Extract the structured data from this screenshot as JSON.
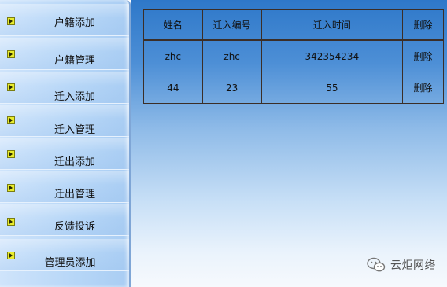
{
  "sidebar": {
    "items": [
      {
        "label": "户籍添加",
        "icon": "arrow-bullet-icon"
      },
      {
        "label": "户籍管理",
        "icon": "arrow-bullet-icon"
      },
      {
        "label": "迁入添加",
        "icon": "arrow-bullet-icon"
      },
      {
        "label": "迁入管理",
        "icon": "arrow-bullet-icon"
      },
      {
        "label": "迁出添加",
        "icon": "arrow-bullet-icon"
      },
      {
        "label": "迁出管理",
        "icon": "arrow-bullet-icon"
      },
      {
        "label": "反馈投诉",
        "icon": "arrow-bullet-icon"
      },
      {
        "label": "管理员添加",
        "icon": "arrow-bullet-icon"
      }
    ],
    "icon_color": "#e9ec2d"
  },
  "table": {
    "headers": [
      "姓名",
      "迁入编号",
      "迁入时间",
      "删除"
    ],
    "rows": [
      {
        "name": "zhc",
        "number": "zhc",
        "time": "342354234",
        "action": "删除"
      },
      {
        "name": "44",
        "number": "23",
        "time": "55",
        "action": "删除"
      }
    ]
  },
  "watermark": {
    "text": "云炬网络",
    "icon": "wechat-icon"
  }
}
